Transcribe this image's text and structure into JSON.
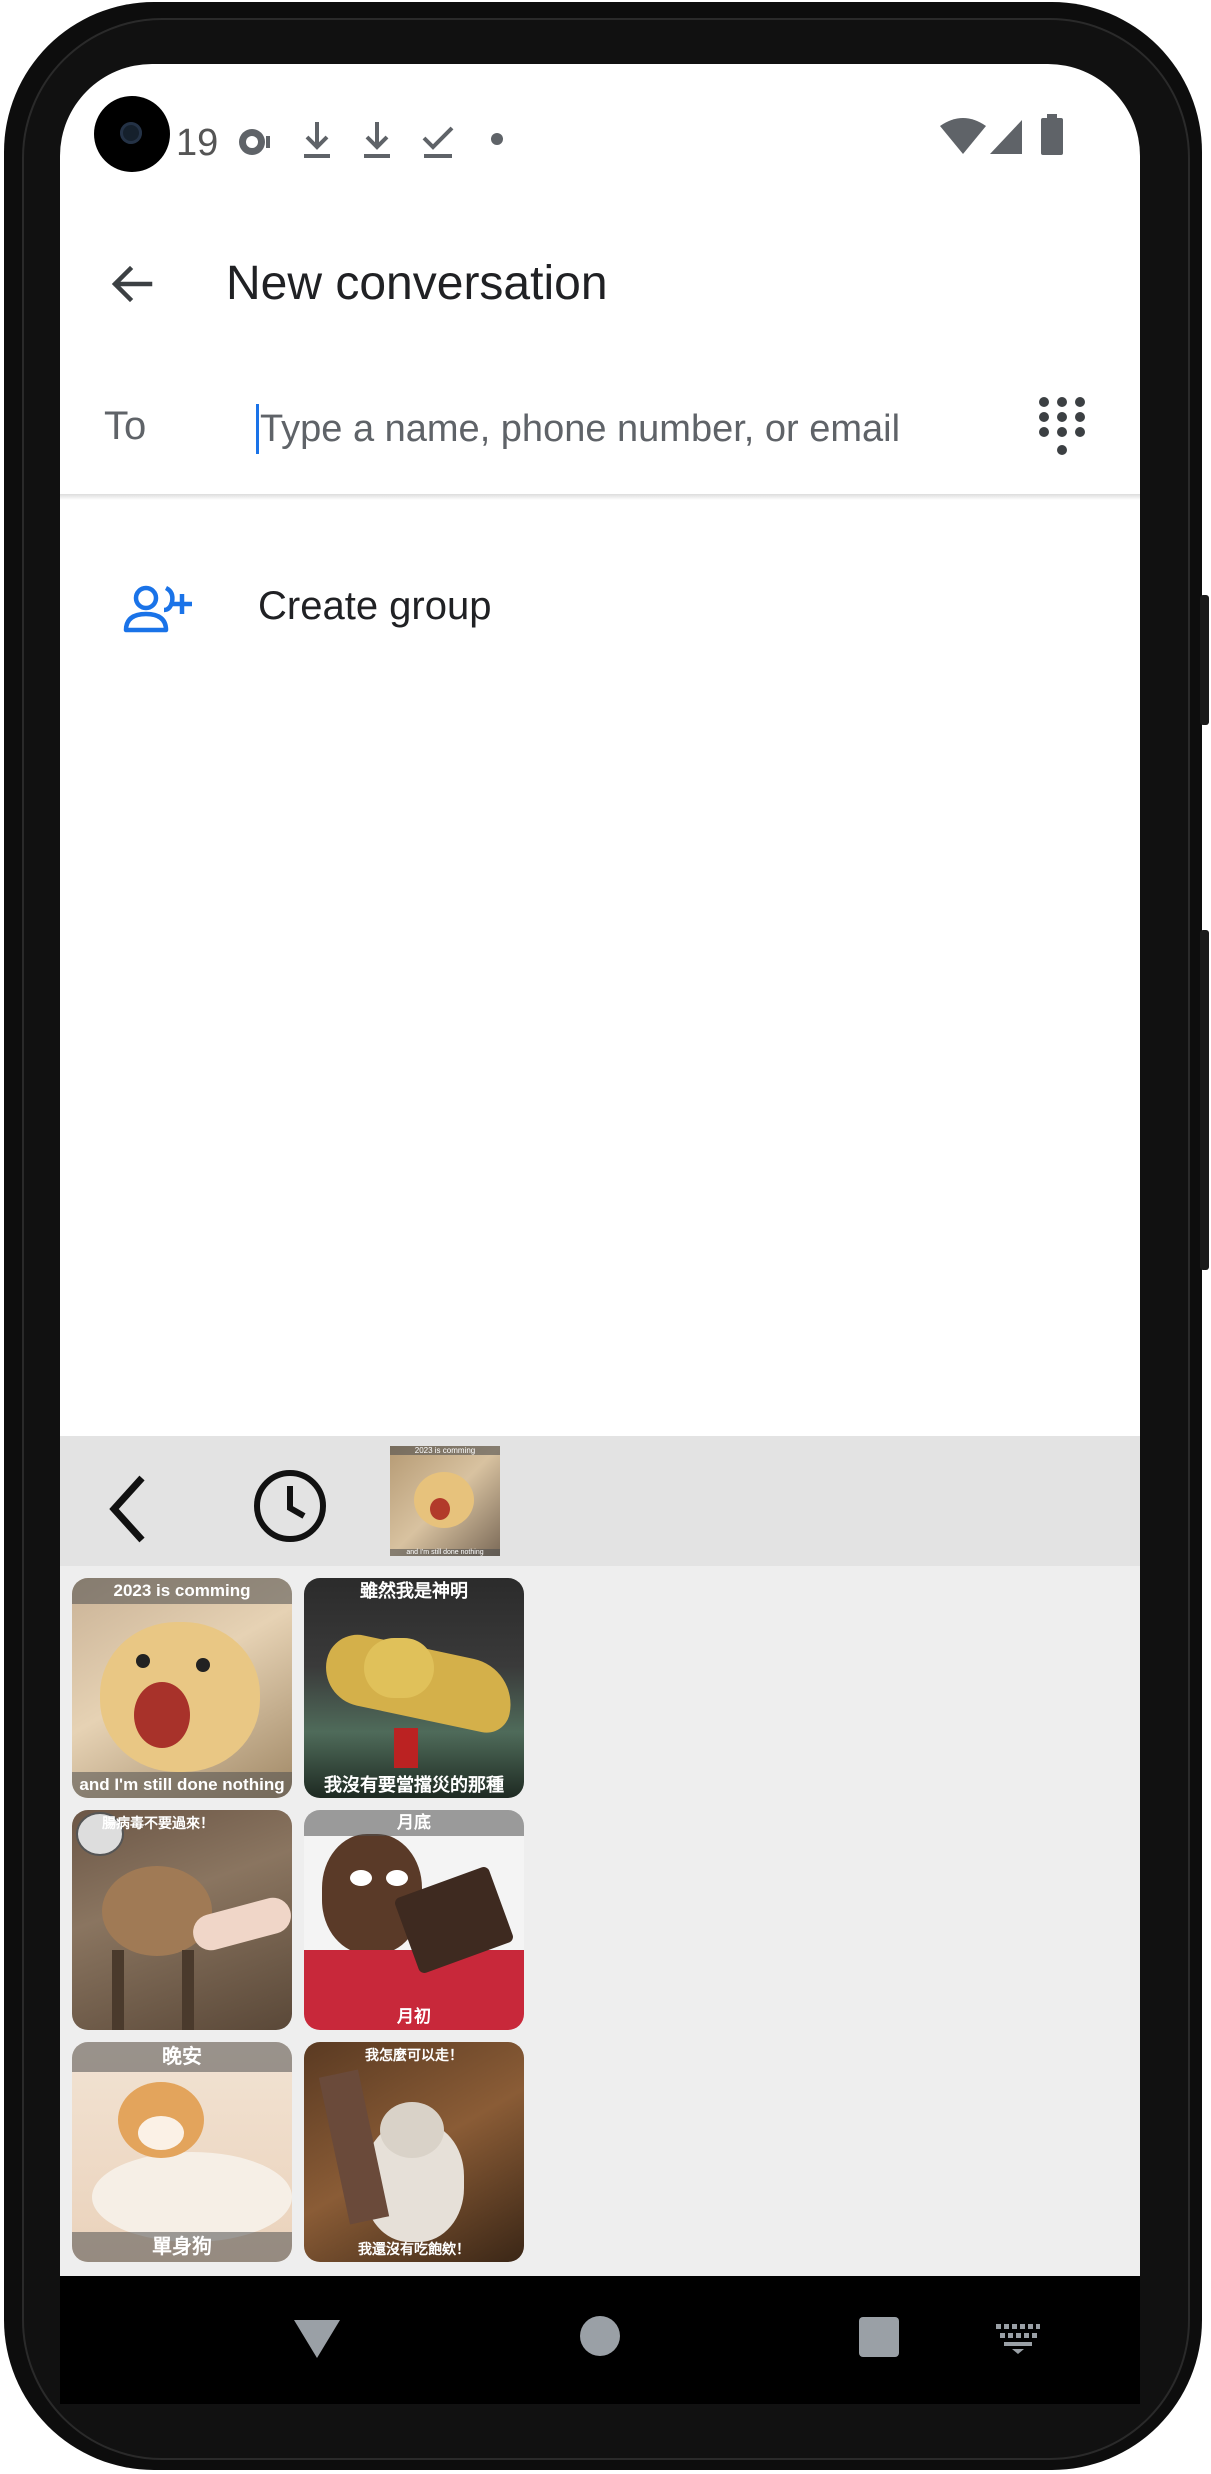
{
  "status_bar": {
    "time": "19",
    "notification_icons": [
      "chat-bubble-icon",
      "download-icon",
      "download-icon",
      "done-icon",
      "dot-icon"
    ],
    "system_icons": [
      "wifi-icon",
      "cellular-signal-icon",
      "battery-icon"
    ]
  },
  "app_bar": {
    "title": "New conversation",
    "back_icon": "arrow-back-icon"
  },
  "recipient": {
    "to_label": "To",
    "placeholder": "Type a name, phone number, or email",
    "value": "",
    "dialpad_icon": "dialpad-icon"
  },
  "actions": {
    "create_group_label": "Create group",
    "create_group_icon": "add-group-icon",
    "accent_color": "#1a73e8"
  },
  "sticker_panel": {
    "tabs": [
      {
        "name": "back",
        "icon": "chevron-left-icon"
      },
      {
        "name": "recent",
        "icon": "clock-icon"
      },
      {
        "name": "pack",
        "thumb_top": "2023 is comming",
        "thumb_bottom": "and I'm still done nothing"
      }
    ],
    "stickers": [
      {
        "top": "2023 is comming",
        "bottom": "and I'm still done nothing"
      },
      {
        "top": "雖然我是神明",
        "bottom": "我沒有要當擋災的那種"
      },
      {
        "top": "腸病毒不要過來！",
        "bottom": ""
      },
      {
        "top": "月底",
        "bottom": "月初"
      },
      {
        "top": "晚安",
        "bottom": "單身狗"
      },
      {
        "top": "我怎麼可以走！",
        "bottom": "我還沒有吃飽欸！"
      }
    ]
  },
  "nav_bar": {
    "buttons": [
      "back-triangle-icon",
      "home-circle-icon",
      "recents-square-icon",
      "keyboard-switch-icon"
    ]
  }
}
